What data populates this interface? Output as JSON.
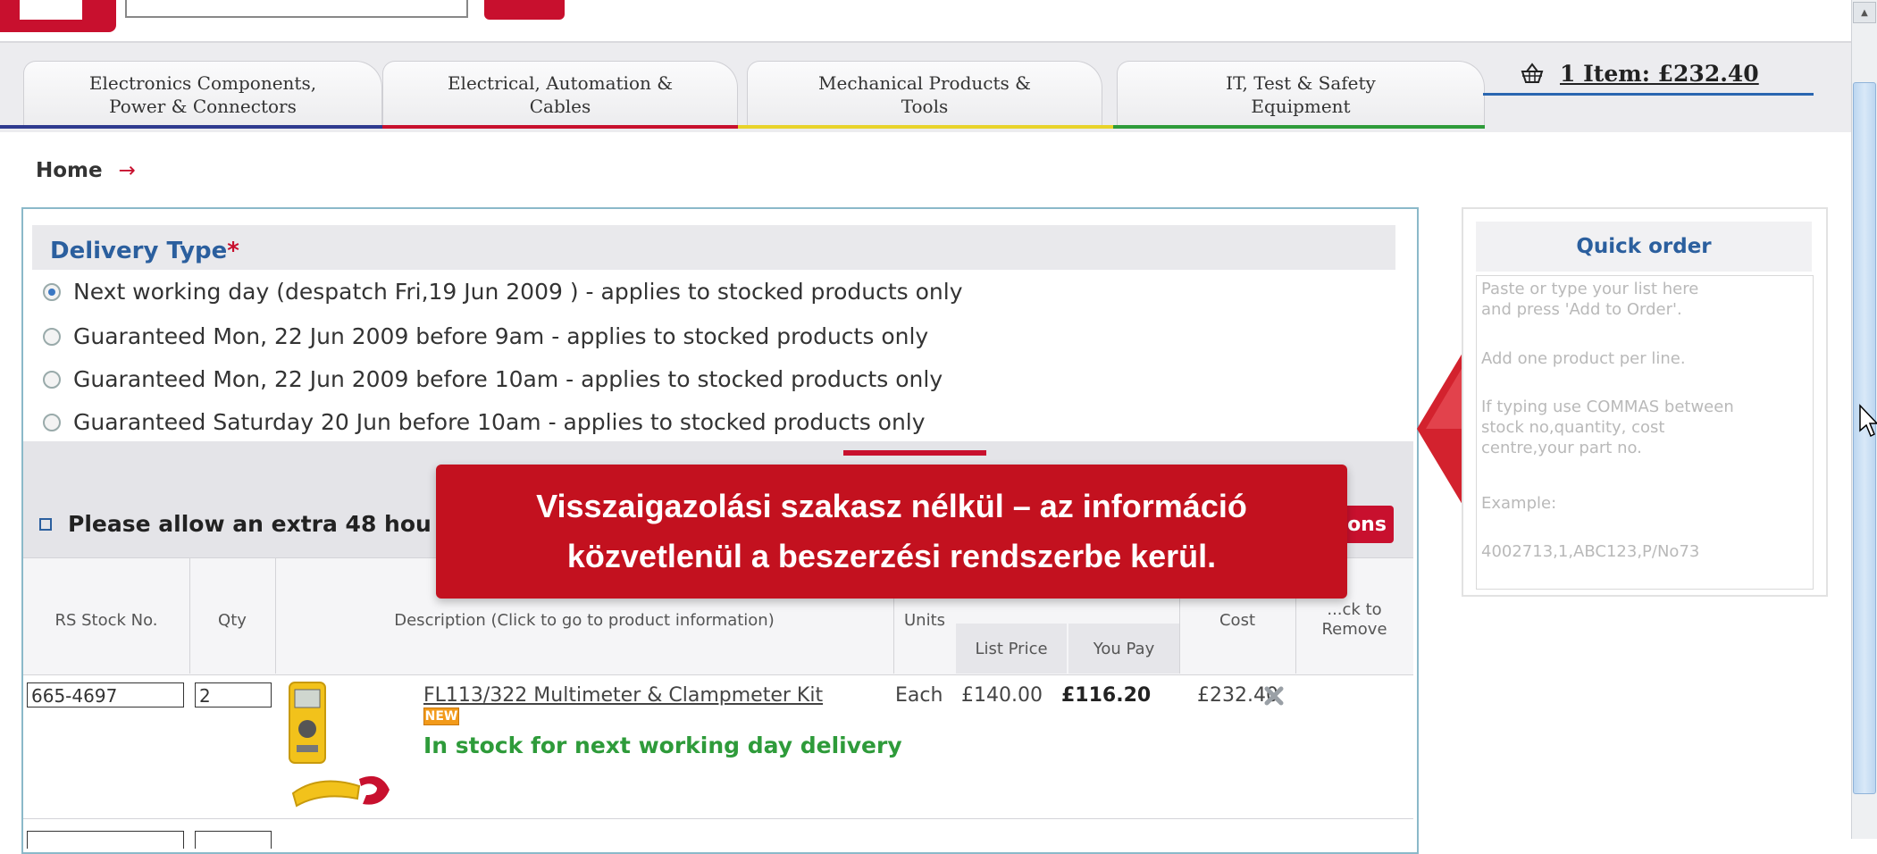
{
  "nav": {
    "tabs": [
      {
        "label": "Electronics Components,\nPower & Connectors",
        "accent": "#2f3b8f"
      },
      {
        "label": "Electrical, Automation &\nCables",
        "accent": "#c8102e"
      },
      {
        "label": "Mechanical Products &\nTools",
        "accent": "#e8d32a"
      },
      {
        "label": "IT, Test & Safety\nEquipment",
        "accent": "#2e9b3a"
      }
    ],
    "basket_text": "1  Item: £232.40"
  },
  "breadcrumb": {
    "home": "Home",
    "arrow": "→"
  },
  "delivery": {
    "title": "Delivery Type",
    "required_mark": "*",
    "options": [
      {
        "label": "Next working day (despatch Fri,19 Jun 2009 ) - applies to stocked products only",
        "selected": true
      },
      {
        "label": "Guaranteed Mon, 22 Jun 2009 before 9am - applies to stocked products only",
        "selected": false
      },
      {
        "label": "Guaranteed Mon, 22 Jun 2009 before 10am - applies to stocked products only",
        "selected": false
      },
      {
        "label": "Guaranteed Saturday 20 Jun before 10am - applies to stocked products only",
        "selected": false
      }
    ]
  },
  "notice": {
    "text": "Please allow an extra 48 hou",
    "options_button": "ons"
  },
  "table": {
    "headers": {
      "stock_no": "RS Stock No.",
      "qty": "Qty",
      "description": "Description (Click to go to product information)",
      "units": "Units",
      "list_price": "List Price",
      "you_pay": "You Pay",
      "cost": "Cost",
      "remove": "...ck to\nRemove"
    },
    "rows": [
      {
        "stock_no": "665-4697",
        "qty": "2",
        "description": "FL113/322 Multimeter & Clampmeter Kit",
        "badge": "NEW",
        "stock_status": "In stock for next working day delivery",
        "units": "Each",
        "list_price": "£140.00",
        "you_pay": "£116.20",
        "cost": "£232.40"
      }
    ]
  },
  "quick_order": {
    "title": "Quick order",
    "placeholder_lines": [
      "Paste or type your list here\nand press 'Add to Order'.",
      "Add one product per line.",
      "If typing use COMMAS between\nstock no,quantity, cost\ncentre,your part no.",
      "Example:",
      "4002713,1,ABC123,P/No73"
    ]
  },
  "caption": {
    "text": "Visszaigazolási szakasz nélkül – az információ\nközvetlenül a beszerzési rendszerbe kerül."
  },
  "colors": {
    "brand_red": "#c8102e",
    "link_blue": "#2b5f9e",
    "stock_green": "#2e9b3a",
    "caption_red": "#c3111f"
  }
}
